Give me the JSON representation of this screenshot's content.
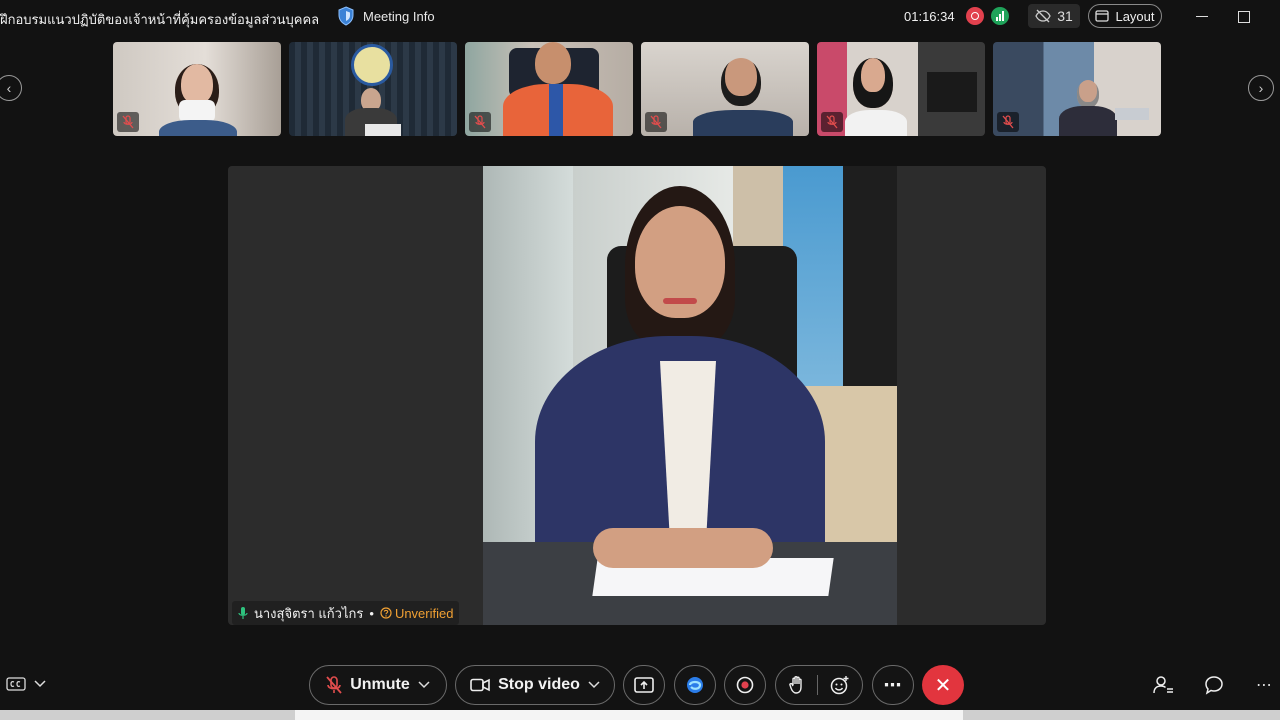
{
  "titlebar": {
    "meeting_title": "ฝึกอบรมแนวปฏิบัติของเจ้าหน้าที่คุ้มครองข้อมูลส่วนบุคคล (D...",
    "meeting_info_label": "Meeting Info",
    "elapsed_time": "01:16:34",
    "participant_count": "31",
    "layout_label": "Layout"
  },
  "stage": {
    "speaker_name": "นางสุจิตรา แก้วไกร",
    "separator": "•",
    "verification_status": "Unverified"
  },
  "controls": {
    "unmute_label": "Unmute",
    "stop_video_label": "Stop video"
  },
  "icons": {
    "shield": "shield-icon",
    "hide_self": "eye-slash-icon",
    "mute": "mic-off-icon",
    "mic": "mic-icon"
  },
  "colors": {
    "record_red": "#e2414e",
    "end_red": "#e2353e",
    "network_green": "#1fa35a",
    "unverified_orange": "#f0a033"
  }
}
